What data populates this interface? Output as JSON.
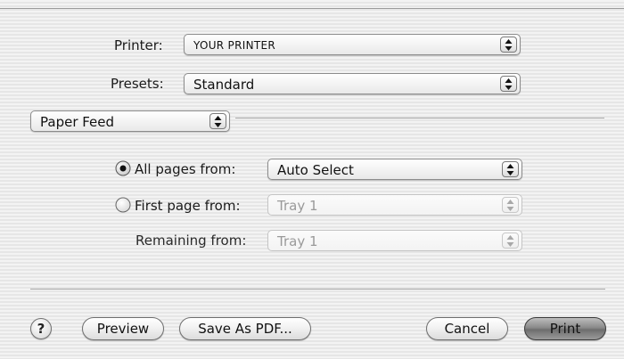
{
  "printer": {
    "label": "Printer:",
    "value": "YOUR PRINTER"
  },
  "presets": {
    "label": "Presets:",
    "value": "Standard"
  },
  "panel": {
    "value": "Paper Feed"
  },
  "paper_feed": {
    "all_pages": {
      "label": "All pages from:",
      "value": "Auto Select",
      "selected": true
    },
    "first_page": {
      "label": "First page from:",
      "value": "Tray 1",
      "selected": false
    },
    "remaining": {
      "label": "Remaining from:",
      "value": "Tray 1"
    }
  },
  "buttons": {
    "help": "?",
    "preview": "Preview",
    "save_pdf": "Save As PDF...",
    "cancel": "Cancel",
    "print": "Print"
  },
  "icons": {
    "popup_arrows": "up-down-arrows-icon",
    "radio_on": "radio-selected-icon",
    "radio_off": "radio-unselected-icon"
  }
}
